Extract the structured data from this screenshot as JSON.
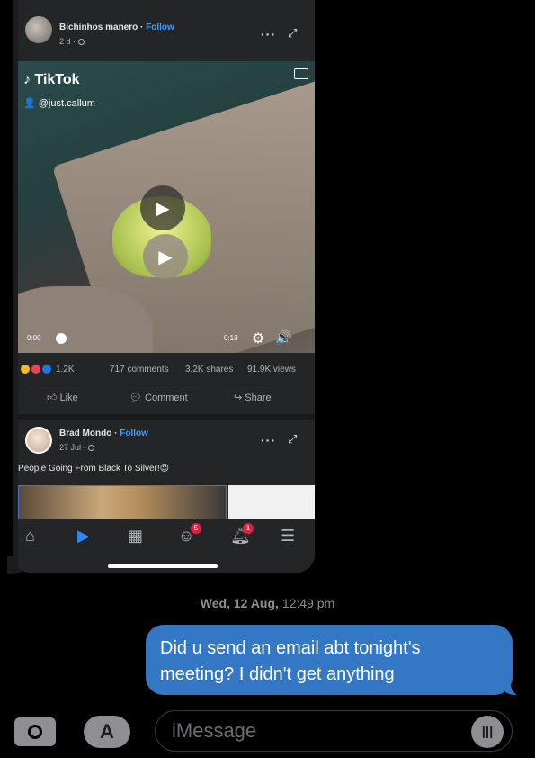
{
  "post1": {
    "author": "Bichinhos manero",
    "follow": "Follow",
    "meta": "2 d ·",
    "tiktok_brand": "TikTok",
    "tiktok_user": "@just.callum",
    "time_start": "0:00",
    "time_end": "0:13",
    "reaction_count": "1.2K",
    "comments": "717 comments",
    "shares": "3.2K shares",
    "views": "91.9K views"
  },
  "actions": {
    "like": "Like",
    "comment": "Comment",
    "share": "Share"
  },
  "post2": {
    "author": "Brad Mondo",
    "follow": "Follow",
    "meta": "27 Jul ·",
    "caption": "People Going From Black To Silver!😍"
  },
  "tabbar": {
    "groups_badge": "5",
    "notifications_badge": "1"
  },
  "conversation": {
    "timestamp_day": "Wed, 12 Aug,",
    "timestamp_time": "12:49 pm",
    "sent_message": "Did u send an email abt tonight's meeting? I didn't get anything"
  },
  "input": {
    "placeholder": "iMessage"
  }
}
